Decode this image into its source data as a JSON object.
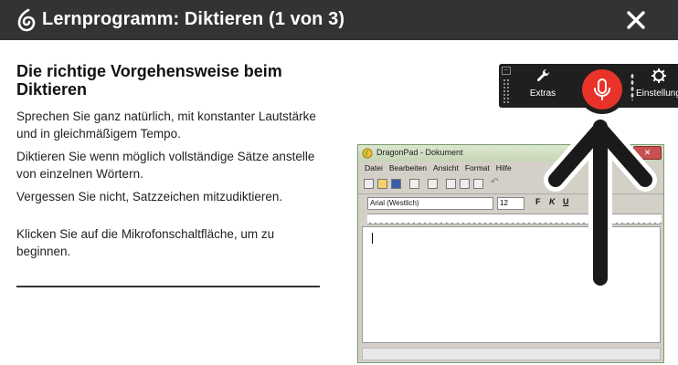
{
  "header": {
    "title": "Lernprogramm: Diktieren (1 von 3)",
    "logo_icon": "dragon-flame-icon",
    "close_icon": "close-icon"
  },
  "main": {
    "heading": "Die richtige Vorgehensweise beim Diktieren",
    "paragraphs": [
      "Sprechen Sie ganz natürlich, mit konstanter Lautstärke und in gleichmäßigem Tempo.",
      "Diktieren Sie wenn möglich vollständige Sätze anstelle von einzelnen Wörtern.",
      "Vergessen Sie nicht, Satzzeichen mitzudiktieren."
    ],
    "instruction": "Klicken Sie auf die Mikrofonschaltfläche, um zu beginnen."
  },
  "dragon_bar": {
    "extras_label": "Extras",
    "settings_label": "Einstellunge",
    "mic_color": "#e8332a",
    "extras_icon": "wrench-icon",
    "settings_icon": "gear-icon",
    "mic_icon": "microphone-icon"
  },
  "dragonpad": {
    "title": "DragonPad - Dokument",
    "menu": [
      "Datei",
      "Bearbeiten",
      "Ansicht",
      "Format",
      "Hilfe"
    ],
    "font": "Arial (Westlich)",
    "size": "12",
    "format_buttons": [
      "F",
      "K",
      "U"
    ]
  }
}
